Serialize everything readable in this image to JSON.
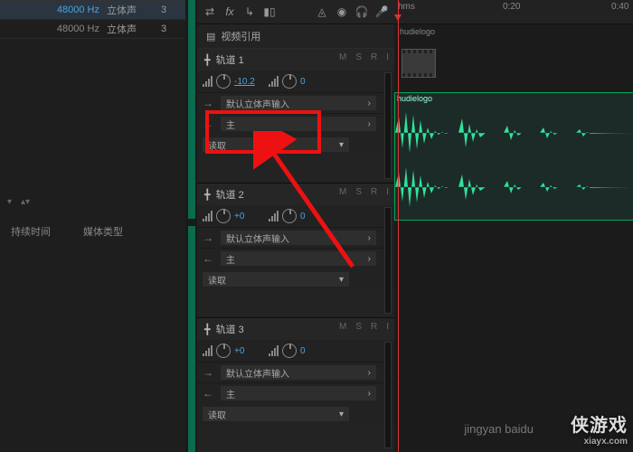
{
  "colors": {
    "accent": "#4aa3df",
    "waveform": "#2fe39b",
    "highlight": "#e11"
  },
  "left": {
    "rows": [
      {
        "hz": "48000 Hz",
        "ch": "立体声",
        "n": "3",
        "sel": true
      },
      {
        "hz": "48000 Hz",
        "ch": "立体声",
        "n": "3",
        "sel": false
      }
    ],
    "time_label": "持续时间",
    "type_label": "媒体类型"
  },
  "toolbar": {
    "icons": [
      "swap",
      "fx",
      "split",
      "chart",
      "sp",
      "tri",
      "person",
      "headphones",
      "mic"
    ]
  },
  "video_ref": "视频引用",
  "ruler": {
    "unit": "hms",
    "marks": [
      "0:20",
      "0:40"
    ]
  },
  "playhead_label": "hudielogo",
  "tracks": [
    {
      "name": "轨道 1",
      "vol": "-10.2",
      "pan": "0",
      "input": "默认立体声输入",
      "output": "主",
      "mode": "读取",
      "m": "M",
      "s": "S",
      "r": "R",
      "i": "I",
      "clip": "hudielogo"
    },
    {
      "name": "轨道 2",
      "vol": "+0",
      "pan": "0",
      "input": "默认立体声输入",
      "output": "主",
      "mode": "读取",
      "m": "M",
      "s": "S",
      "r": "R",
      "i": "I"
    },
    {
      "name": "轨道 3",
      "vol": "+0",
      "pan": "0",
      "input": "默认立体声输入",
      "output": "主",
      "mode": "读取",
      "m": "M",
      "s": "S",
      "r": "R",
      "i": "I"
    }
  ],
  "watermark": {
    "site": "xiayx.com",
    "brand": "侠"
  },
  "watermark2": "jingyan baidu"
}
